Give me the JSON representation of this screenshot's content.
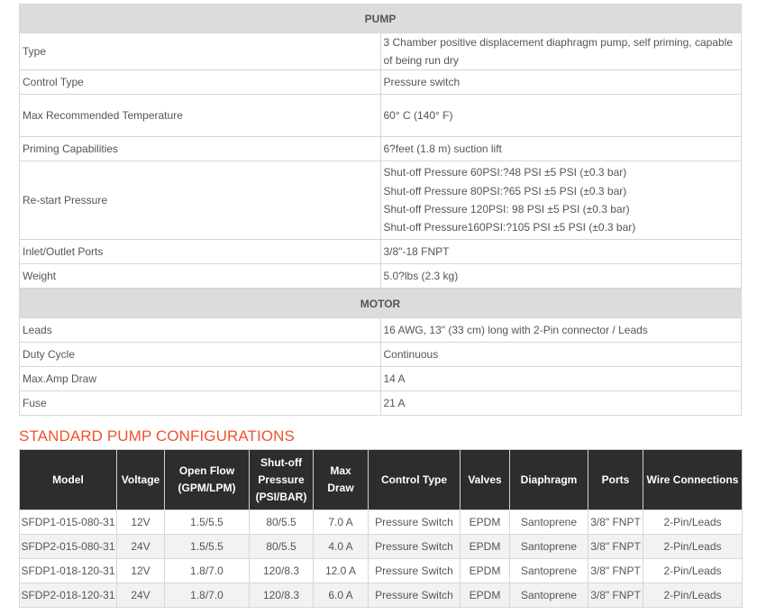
{
  "pump": {
    "header": "PUMP",
    "rows": [
      {
        "label": "Type",
        "values": [
          "3 Chamber positive displacement diaphragm pump, self priming, capable of being run dry"
        ]
      },
      {
        "label": "Control Type",
        "values": [
          "Pressure switch"
        ]
      },
      {
        "label": "Max Recommended Temperature",
        "values": [
          "60° C  (140° F)"
        ]
      },
      {
        "label": "Priming Capabilities",
        "values": [
          "6?feet (1.8 m) suction lift"
        ]
      },
      {
        "label": "Re-start Pressure",
        "values": [
          "Shut-off Pressure 60PSI:?48 PSI ±5 PSI (±0.3 bar)",
          "Shut-off Pressure 80PSI:?65 PSI ±5 PSI (±0.3 bar)",
          "Shut-off Pressure 120PSI: 98 PSI ±5 PSI (±0.3 bar)",
          "Shut-off Pressure160PSI:?105 PSI ±5 PSI (±0.3 bar)"
        ]
      },
      {
        "label": "Inlet/Outlet Ports",
        "values": [
          "3/8\"-18 FNPT"
        ]
      },
      {
        "label": "Weight",
        "values": [
          "5.0?lbs (2.3 kg)"
        ]
      }
    ]
  },
  "motor": {
    "header": "MOTOR",
    "rows": [
      {
        "label": "Leads",
        "value": "16 AWG, 13\" (33 cm) long with 2-Pin connector / Leads"
      },
      {
        "label": "Duty Cycle",
        "value": "Continuous"
      },
      {
        "label": "Max.Amp Draw",
        "value": "14 A"
      },
      {
        "label": "Fuse",
        "value": "21 A"
      }
    ]
  },
  "configurations": {
    "title": "STANDARD PUMP CONFIGURATIONS",
    "columns": [
      "Model",
      "Voltage",
      "Open Flow (GPM/LPM)",
      "Shut-off Pressure (PSI/BAR)",
      "Max Draw",
      "Control Type",
      "Valves",
      "Diaphragm",
      "Ports",
      "Wire Connections"
    ],
    "rows": [
      [
        "SFDP1-015-080-31",
        "12V",
        "1.5/5.5",
        "80/5.5",
        "7.0 A",
        "Pressure Switch",
        "EPDM",
        "Santoprene",
        "3/8\" FNPT",
        "2-Pin/Leads"
      ],
      [
        "SFDP2-015-080-31",
        "24V",
        "1.5/5.5",
        "80/5.5",
        "4.0 A",
        "Pressure Switch",
        "EPDM",
        "Santoprene",
        "3/8\" FNPT",
        "2-Pin/Leads"
      ],
      [
        "SFDP1-018-120-31",
        "12V",
        "1.8/7.0",
        "120/8.3",
        "12.0 A",
        "Pressure Switch",
        "EPDM",
        "Santoprene",
        "3/8\" FNPT",
        "2-Pin/Leads"
      ],
      [
        "SFDP2-018-120-31",
        "24V",
        "1.8/7.0",
        "120/8.3",
        "6.0 A",
        "Pressure Switch",
        "EPDM",
        "Santoprene",
        "3/8\" FNPT",
        "2-Pin/Leads"
      ]
    ]
  },
  "colors": {
    "accent": "#f0532b",
    "table_header_dark": "#2d2d2d",
    "spec_header_bg": "#dcdcdc",
    "row_shade": "#f2f2f2"
  }
}
